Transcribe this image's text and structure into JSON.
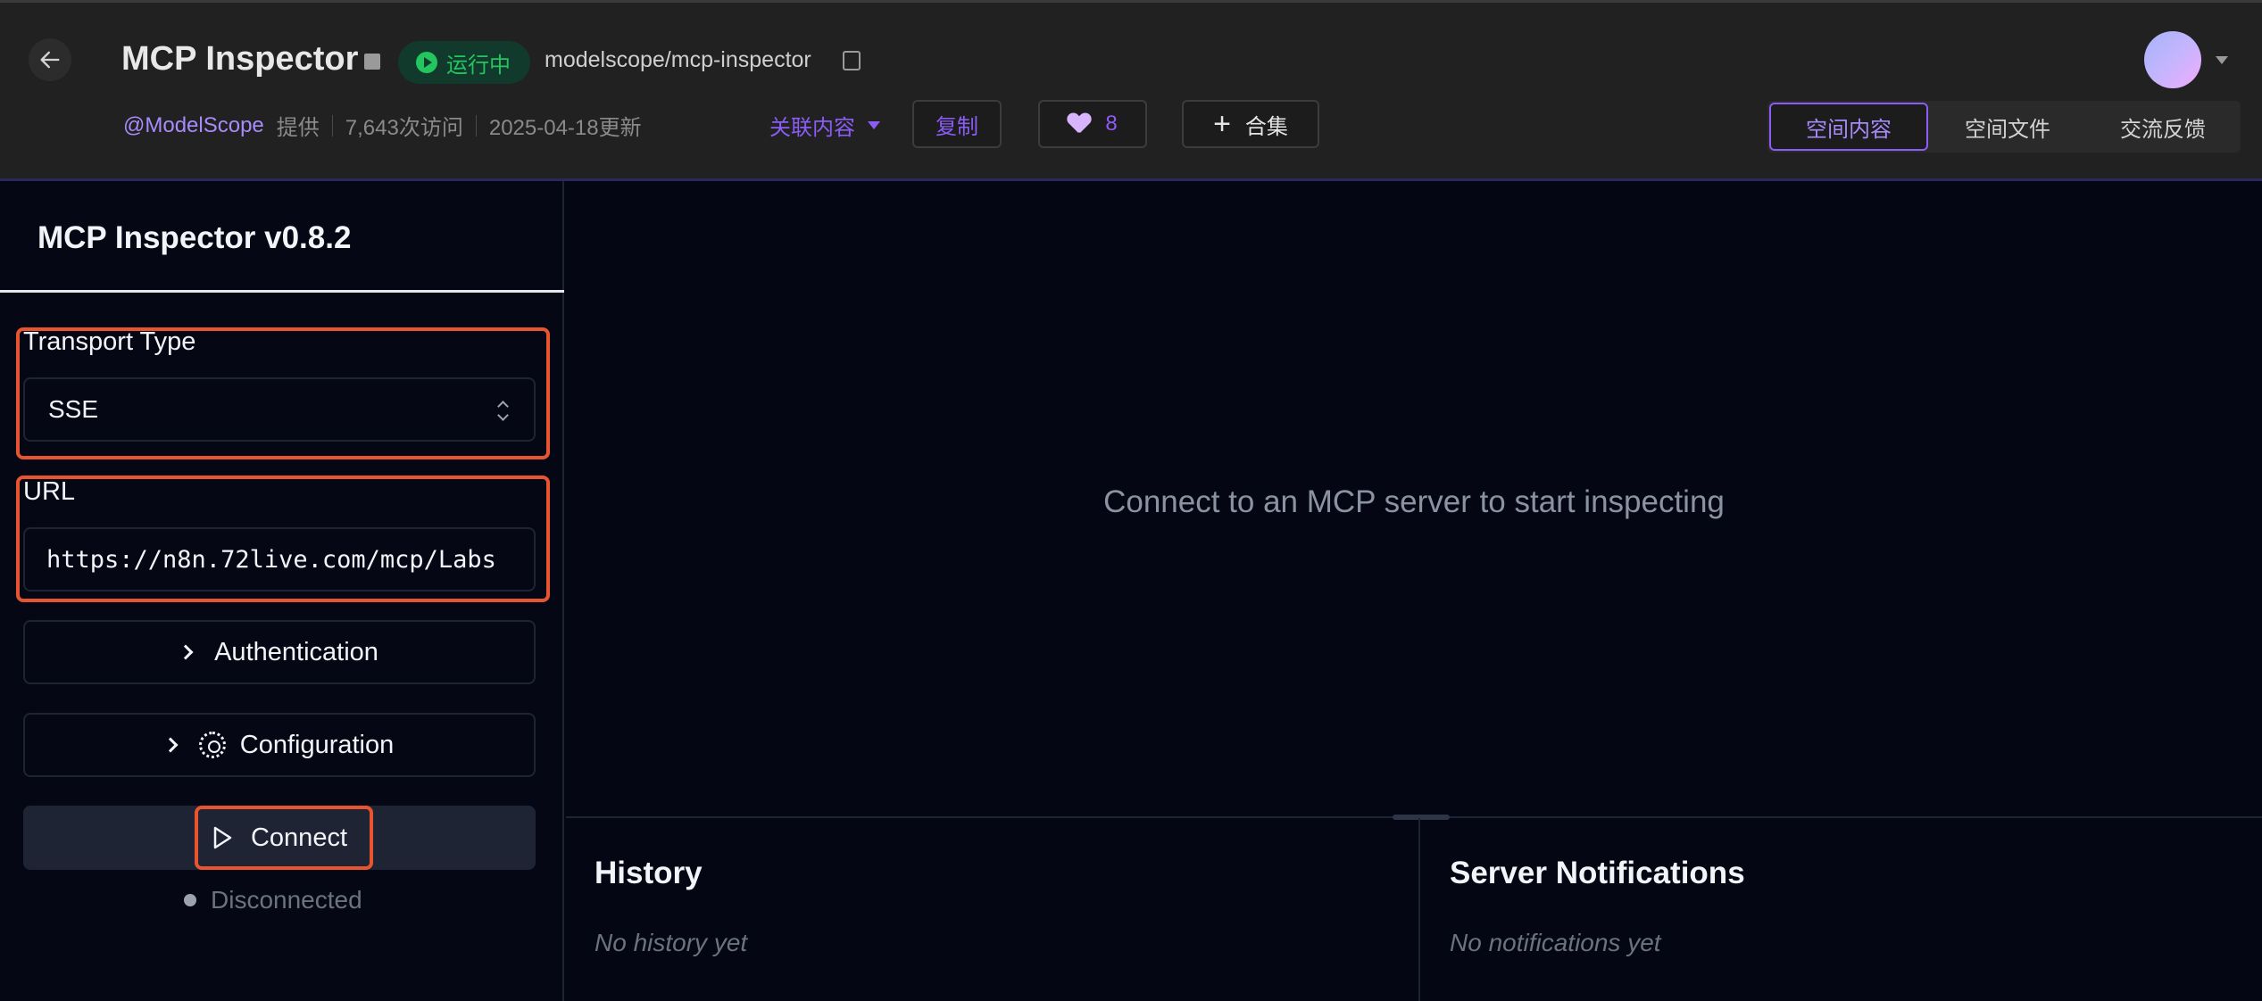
{
  "header": {
    "title": "MCP Inspector",
    "status_badge": "运行中",
    "repo_path": "modelscope/mcp-inspector",
    "provider": "@ModelScope",
    "provider_suffix": "提供",
    "visits": "7,643次访问",
    "updated": "2025-04-18更新",
    "related_label": "关联内容",
    "copy_label": "复制",
    "likes": "8",
    "collection_label": "合集",
    "tabs": [
      {
        "label": "空间内容",
        "active": true
      },
      {
        "label": "空间文件",
        "active": false
      },
      {
        "label": "交流反馈",
        "active": false
      }
    ]
  },
  "sidebar": {
    "title": "MCP Inspector v0.8.2",
    "transport_label": "Transport Type",
    "transport_value": "SSE",
    "url_label": "URL",
    "url_value": "https://n8n.72live.com/mcp/Labs",
    "auth_label": "Authentication",
    "config_label": "Configuration",
    "connect_label": "Connect",
    "status": "Disconnected"
  },
  "main": {
    "placeholder": "Connect to an MCP server to start inspecting",
    "history_title": "History",
    "history_empty": "No history yet",
    "notifications_title": "Server Notifications",
    "notifications_empty": "No notifications yet"
  },
  "colors": {
    "accent": "#8b5cf6",
    "running": "#22c55e",
    "highlight": "#e8542f",
    "app_bg": "#040713"
  }
}
